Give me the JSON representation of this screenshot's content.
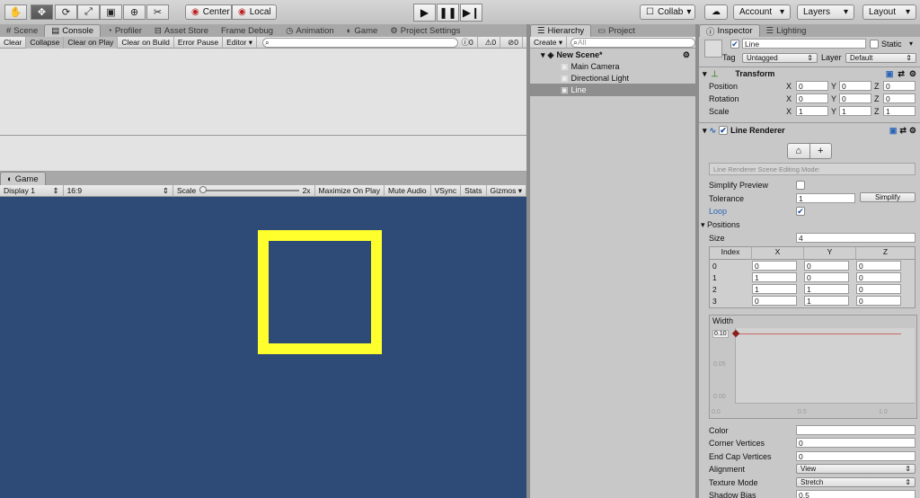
{
  "toolbar": {
    "tools": [
      "hand-icon",
      "move-icon",
      "rotate-icon",
      "scale-icon",
      "rect-icon",
      "transform-icon",
      "custom-tool-icon"
    ],
    "pivot": "Center",
    "space": "Local",
    "collab": "Collab",
    "account": "Account",
    "layers": "Layers",
    "layout": "Layout"
  },
  "upper_tabs": [
    "Scene",
    "Console",
    "Profiler",
    "Asset Store",
    "Frame Debug",
    "Animation",
    "Game",
    "Project Settings"
  ],
  "console_bar": {
    "buttons": [
      "Clear",
      "Collapse",
      "Clear on Play",
      "Clear on Build",
      "Error Pause",
      "Editor"
    ],
    "counts": [
      "0",
      "0",
      "0"
    ]
  },
  "game": {
    "tab": "Game",
    "display": "Display 1",
    "aspect": "16:9",
    "scale_label": "Scale",
    "scale_value": "2x",
    "buttons": [
      "Maximize On Play",
      "Mute Audio",
      "VSync",
      "Stats",
      "Gizmos"
    ],
    "bg_color": "#2e4a76",
    "square_color": "#ffff2e"
  },
  "hierarchy": {
    "tabs": [
      "Hierarchy",
      "Project"
    ],
    "create": "Create",
    "search_placeholder": "All",
    "scene": "New Scene*",
    "items": [
      "Main Camera",
      "Directional Light",
      "Line"
    ],
    "selected": "Line"
  },
  "inspector": {
    "tabs": [
      "Inspector",
      "Lighting"
    ],
    "object_name": "Line",
    "static_label": "Static",
    "tag_label": "Tag",
    "tag_value": "Untagged",
    "layer_label": "Layer",
    "layer_value": "Default",
    "transform": {
      "title": "Transform",
      "rows": [
        {
          "label": "Position",
          "x": "0",
          "y": "0",
          "z": "0"
        },
        {
          "label": "Rotation",
          "x": "0",
          "y": "0",
          "z": "0"
        },
        {
          "label": "Scale",
          "x": "1",
          "y": "1",
          "z": "1"
        }
      ]
    },
    "line_renderer": {
      "title": "Line Renderer",
      "edit_mode_hint": "Line Renderer Scene Editing Mode:",
      "simplify_preview": "Simplify Preview",
      "tolerance_label": "Tolerance",
      "tolerance_value": "1",
      "simplify_button": "Simplify",
      "loop_label": "Loop",
      "positions_label": "Positions",
      "size_label": "Size",
      "size_value": "4",
      "columns": [
        "Index",
        "X",
        "Y",
        "Z"
      ],
      "points": [
        [
          "0",
          "0",
          "0",
          "0"
        ],
        [
          "1",
          "1",
          "0",
          "0"
        ],
        [
          "2",
          "1",
          "1",
          "0"
        ],
        [
          "3",
          "0",
          "1",
          "0"
        ]
      ],
      "width_label": "Width",
      "width_axis_y": [
        "0.10",
        "0.05",
        "0.00"
      ],
      "width_axis_x": [
        "0.0",
        "0.5",
        "1.0"
      ],
      "properties": [
        {
          "label": "Color",
          "value": ""
        },
        {
          "label": "Corner Vertices",
          "value": "0"
        },
        {
          "label": "End Cap Vertices",
          "value": "0"
        },
        {
          "label": "Alignment",
          "value": "View"
        },
        {
          "label": "Texture Mode",
          "value": "Stretch"
        },
        {
          "label": "Shadow Bias",
          "value": "0.5"
        }
      ]
    }
  }
}
